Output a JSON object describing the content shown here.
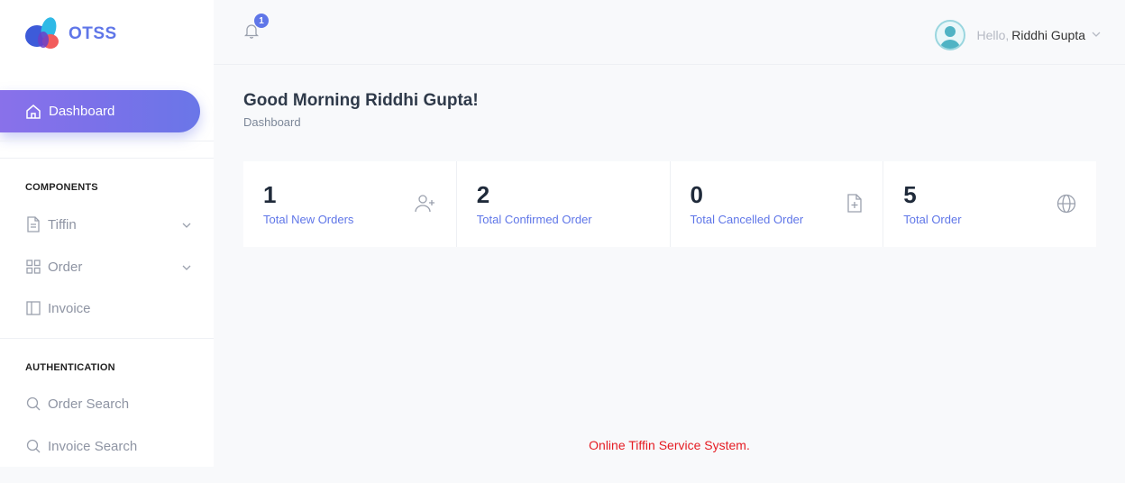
{
  "app": {
    "logo_text": "OTSS"
  },
  "sidebar": {
    "active_item": {
      "label": "Dashboard",
      "icon": "home-icon"
    },
    "sections": [
      {
        "caption": "COMPONENTS",
        "items": [
          {
            "label": "Tiffin",
            "icon": "file-icon",
            "has_dropdown": true
          },
          {
            "label": "Order",
            "icon": "grid-icon",
            "has_dropdown": true
          },
          {
            "label": "Invoice",
            "icon": "sidebar-panel-icon",
            "has_dropdown": false
          }
        ]
      },
      {
        "caption": "AUTHENTICATION",
        "items": [
          {
            "label": "Order Search",
            "icon": "search-icon"
          },
          {
            "label": "Invoice Search",
            "icon": "search-icon"
          }
        ]
      }
    ]
  },
  "topbar": {
    "notification_count": "1",
    "greeting_prefix": "Hello,",
    "user_name": "Riddhi Gupta"
  },
  "page": {
    "greeting": "Good Morning Riddhi Gupta!",
    "breadcrumb": "Dashboard"
  },
  "stats": [
    {
      "value": "1",
      "label": "Total New Orders",
      "icon": "user-plus-icon"
    },
    {
      "value": "2",
      "label": "Total Confirmed Order",
      "icon": ""
    },
    {
      "value": "0",
      "label": "Total Cancelled Order",
      "icon": "file-plus-icon"
    },
    {
      "value": "5",
      "label": "Total Order",
      "icon": "globe-icon"
    }
  ],
  "footer": {
    "text": "Online Tiffin Service System."
  },
  "colors": {
    "accent": "#5f76e8",
    "gradient_start": "#8971ea",
    "footer_text": "#e51c23"
  }
}
